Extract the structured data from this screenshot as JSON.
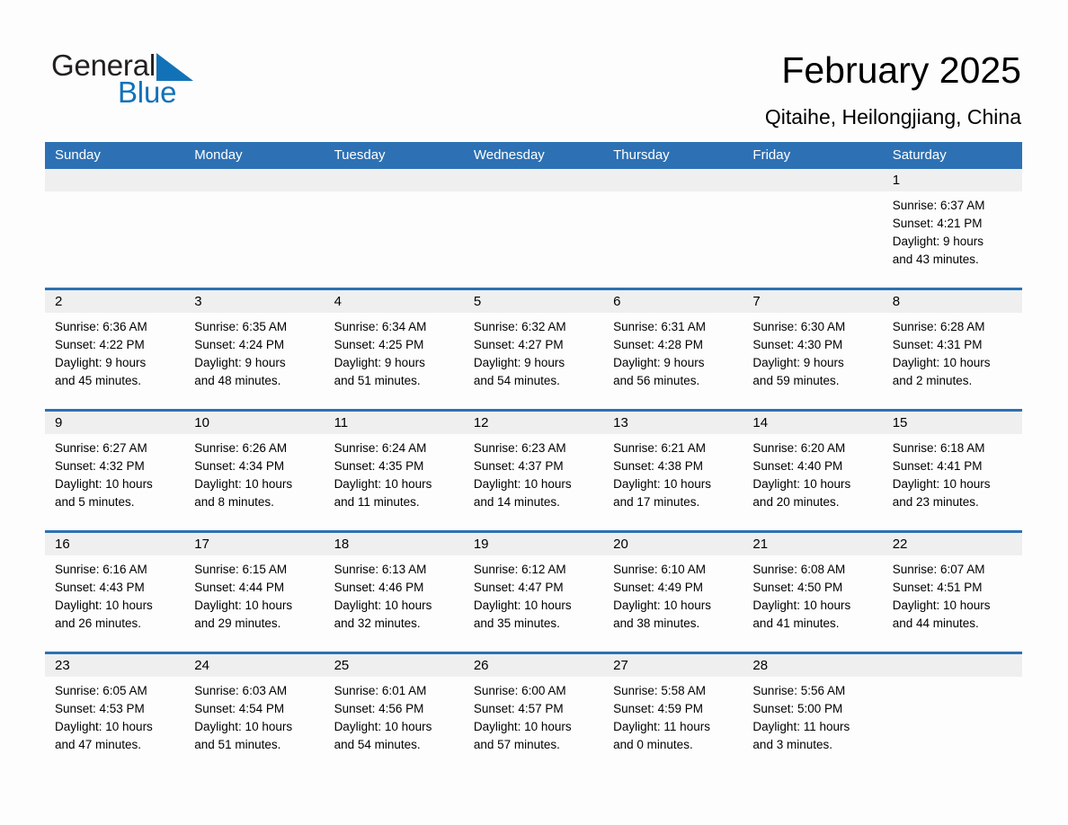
{
  "brand": {
    "name_part1": "General",
    "name_part2": "Blue",
    "triangle_color": "#1272b8",
    "text_color": "#231f20"
  },
  "header": {
    "title": "February 2025",
    "subtitle": "Qitaihe, Heilongjiang, China",
    "accent_color": "#2d71b4",
    "day_band_color": "#efefef"
  },
  "calendar": {
    "weekdays": [
      "Sunday",
      "Monday",
      "Tuesday",
      "Wednesday",
      "Thursday",
      "Friday",
      "Saturday"
    ],
    "weeks": [
      [
        {
          "blank": true
        },
        {
          "blank": true
        },
        {
          "blank": true
        },
        {
          "blank": true
        },
        {
          "blank": true
        },
        {
          "blank": true
        },
        {
          "day": "1",
          "sunrise": "Sunrise: 6:37 AM",
          "sunset": "Sunset: 4:21 PM",
          "daylight_line1": "Daylight: 9 hours",
          "daylight_line2": "and 43 minutes."
        }
      ],
      [
        {
          "day": "2",
          "sunrise": "Sunrise: 6:36 AM",
          "sunset": "Sunset: 4:22 PM",
          "daylight_line1": "Daylight: 9 hours",
          "daylight_line2": "and 45 minutes."
        },
        {
          "day": "3",
          "sunrise": "Sunrise: 6:35 AM",
          "sunset": "Sunset: 4:24 PM",
          "daylight_line1": "Daylight: 9 hours",
          "daylight_line2": "and 48 minutes."
        },
        {
          "day": "4",
          "sunrise": "Sunrise: 6:34 AM",
          "sunset": "Sunset: 4:25 PM",
          "daylight_line1": "Daylight: 9 hours",
          "daylight_line2": "and 51 minutes."
        },
        {
          "day": "5",
          "sunrise": "Sunrise: 6:32 AM",
          "sunset": "Sunset: 4:27 PM",
          "daylight_line1": "Daylight: 9 hours",
          "daylight_line2": "and 54 minutes."
        },
        {
          "day": "6",
          "sunrise": "Sunrise: 6:31 AM",
          "sunset": "Sunset: 4:28 PM",
          "daylight_line1": "Daylight: 9 hours",
          "daylight_line2": "and 56 minutes."
        },
        {
          "day": "7",
          "sunrise": "Sunrise: 6:30 AM",
          "sunset": "Sunset: 4:30 PM",
          "daylight_line1": "Daylight: 9 hours",
          "daylight_line2": "and 59 minutes."
        },
        {
          "day": "8",
          "sunrise": "Sunrise: 6:28 AM",
          "sunset": "Sunset: 4:31 PM",
          "daylight_line1": "Daylight: 10 hours",
          "daylight_line2": "and 2 minutes."
        }
      ],
      [
        {
          "day": "9",
          "sunrise": "Sunrise: 6:27 AM",
          "sunset": "Sunset: 4:32 PM",
          "daylight_line1": "Daylight: 10 hours",
          "daylight_line2": "and 5 minutes."
        },
        {
          "day": "10",
          "sunrise": "Sunrise: 6:26 AM",
          "sunset": "Sunset: 4:34 PM",
          "daylight_line1": "Daylight: 10 hours",
          "daylight_line2": "and 8 minutes."
        },
        {
          "day": "11",
          "sunrise": "Sunrise: 6:24 AM",
          "sunset": "Sunset: 4:35 PM",
          "daylight_line1": "Daylight: 10 hours",
          "daylight_line2": "and 11 minutes."
        },
        {
          "day": "12",
          "sunrise": "Sunrise: 6:23 AM",
          "sunset": "Sunset: 4:37 PM",
          "daylight_line1": "Daylight: 10 hours",
          "daylight_line2": "and 14 minutes."
        },
        {
          "day": "13",
          "sunrise": "Sunrise: 6:21 AM",
          "sunset": "Sunset: 4:38 PM",
          "daylight_line1": "Daylight: 10 hours",
          "daylight_line2": "and 17 minutes."
        },
        {
          "day": "14",
          "sunrise": "Sunrise: 6:20 AM",
          "sunset": "Sunset: 4:40 PM",
          "daylight_line1": "Daylight: 10 hours",
          "daylight_line2": "and 20 minutes."
        },
        {
          "day": "15",
          "sunrise": "Sunrise: 6:18 AM",
          "sunset": "Sunset: 4:41 PM",
          "daylight_line1": "Daylight: 10 hours",
          "daylight_line2": "and 23 minutes."
        }
      ],
      [
        {
          "day": "16",
          "sunrise": "Sunrise: 6:16 AM",
          "sunset": "Sunset: 4:43 PM",
          "daylight_line1": "Daylight: 10 hours",
          "daylight_line2": "and 26 minutes."
        },
        {
          "day": "17",
          "sunrise": "Sunrise: 6:15 AM",
          "sunset": "Sunset: 4:44 PM",
          "daylight_line1": "Daylight: 10 hours",
          "daylight_line2": "and 29 minutes."
        },
        {
          "day": "18",
          "sunrise": "Sunrise: 6:13 AM",
          "sunset": "Sunset: 4:46 PM",
          "daylight_line1": "Daylight: 10 hours",
          "daylight_line2": "and 32 minutes."
        },
        {
          "day": "19",
          "sunrise": "Sunrise: 6:12 AM",
          "sunset": "Sunset: 4:47 PM",
          "daylight_line1": "Daylight: 10 hours",
          "daylight_line2": "and 35 minutes."
        },
        {
          "day": "20",
          "sunrise": "Sunrise: 6:10 AM",
          "sunset": "Sunset: 4:49 PM",
          "daylight_line1": "Daylight: 10 hours",
          "daylight_line2": "and 38 minutes."
        },
        {
          "day": "21",
          "sunrise": "Sunrise: 6:08 AM",
          "sunset": "Sunset: 4:50 PM",
          "daylight_line1": "Daylight: 10 hours",
          "daylight_line2": "and 41 minutes."
        },
        {
          "day": "22",
          "sunrise": "Sunrise: 6:07 AM",
          "sunset": "Sunset: 4:51 PM",
          "daylight_line1": "Daylight: 10 hours",
          "daylight_line2": "and 44 minutes."
        }
      ],
      [
        {
          "day": "23",
          "sunrise": "Sunrise: 6:05 AM",
          "sunset": "Sunset: 4:53 PM",
          "daylight_line1": "Daylight: 10 hours",
          "daylight_line2": "and 47 minutes."
        },
        {
          "day": "24",
          "sunrise": "Sunrise: 6:03 AM",
          "sunset": "Sunset: 4:54 PM",
          "daylight_line1": "Daylight: 10 hours",
          "daylight_line2": "and 51 minutes."
        },
        {
          "day": "25",
          "sunrise": "Sunrise: 6:01 AM",
          "sunset": "Sunset: 4:56 PM",
          "daylight_line1": "Daylight: 10 hours",
          "daylight_line2": "and 54 minutes."
        },
        {
          "day": "26",
          "sunrise": "Sunrise: 6:00 AM",
          "sunset": "Sunset: 4:57 PM",
          "daylight_line1": "Daylight: 10 hours",
          "daylight_line2": "and 57 minutes."
        },
        {
          "day": "27",
          "sunrise": "Sunrise: 5:58 AM",
          "sunset": "Sunset: 4:59 PM",
          "daylight_line1": "Daylight: 11 hours",
          "daylight_line2": "and 0 minutes."
        },
        {
          "day": "28",
          "sunrise": "Sunrise: 5:56 AM",
          "sunset": "Sunset: 5:00 PM",
          "daylight_line1": "Daylight: 11 hours",
          "daylight_line2": "and 3 minutes."
        },
        {
          "blank": true
        }
      ]
    ]
  }
}
